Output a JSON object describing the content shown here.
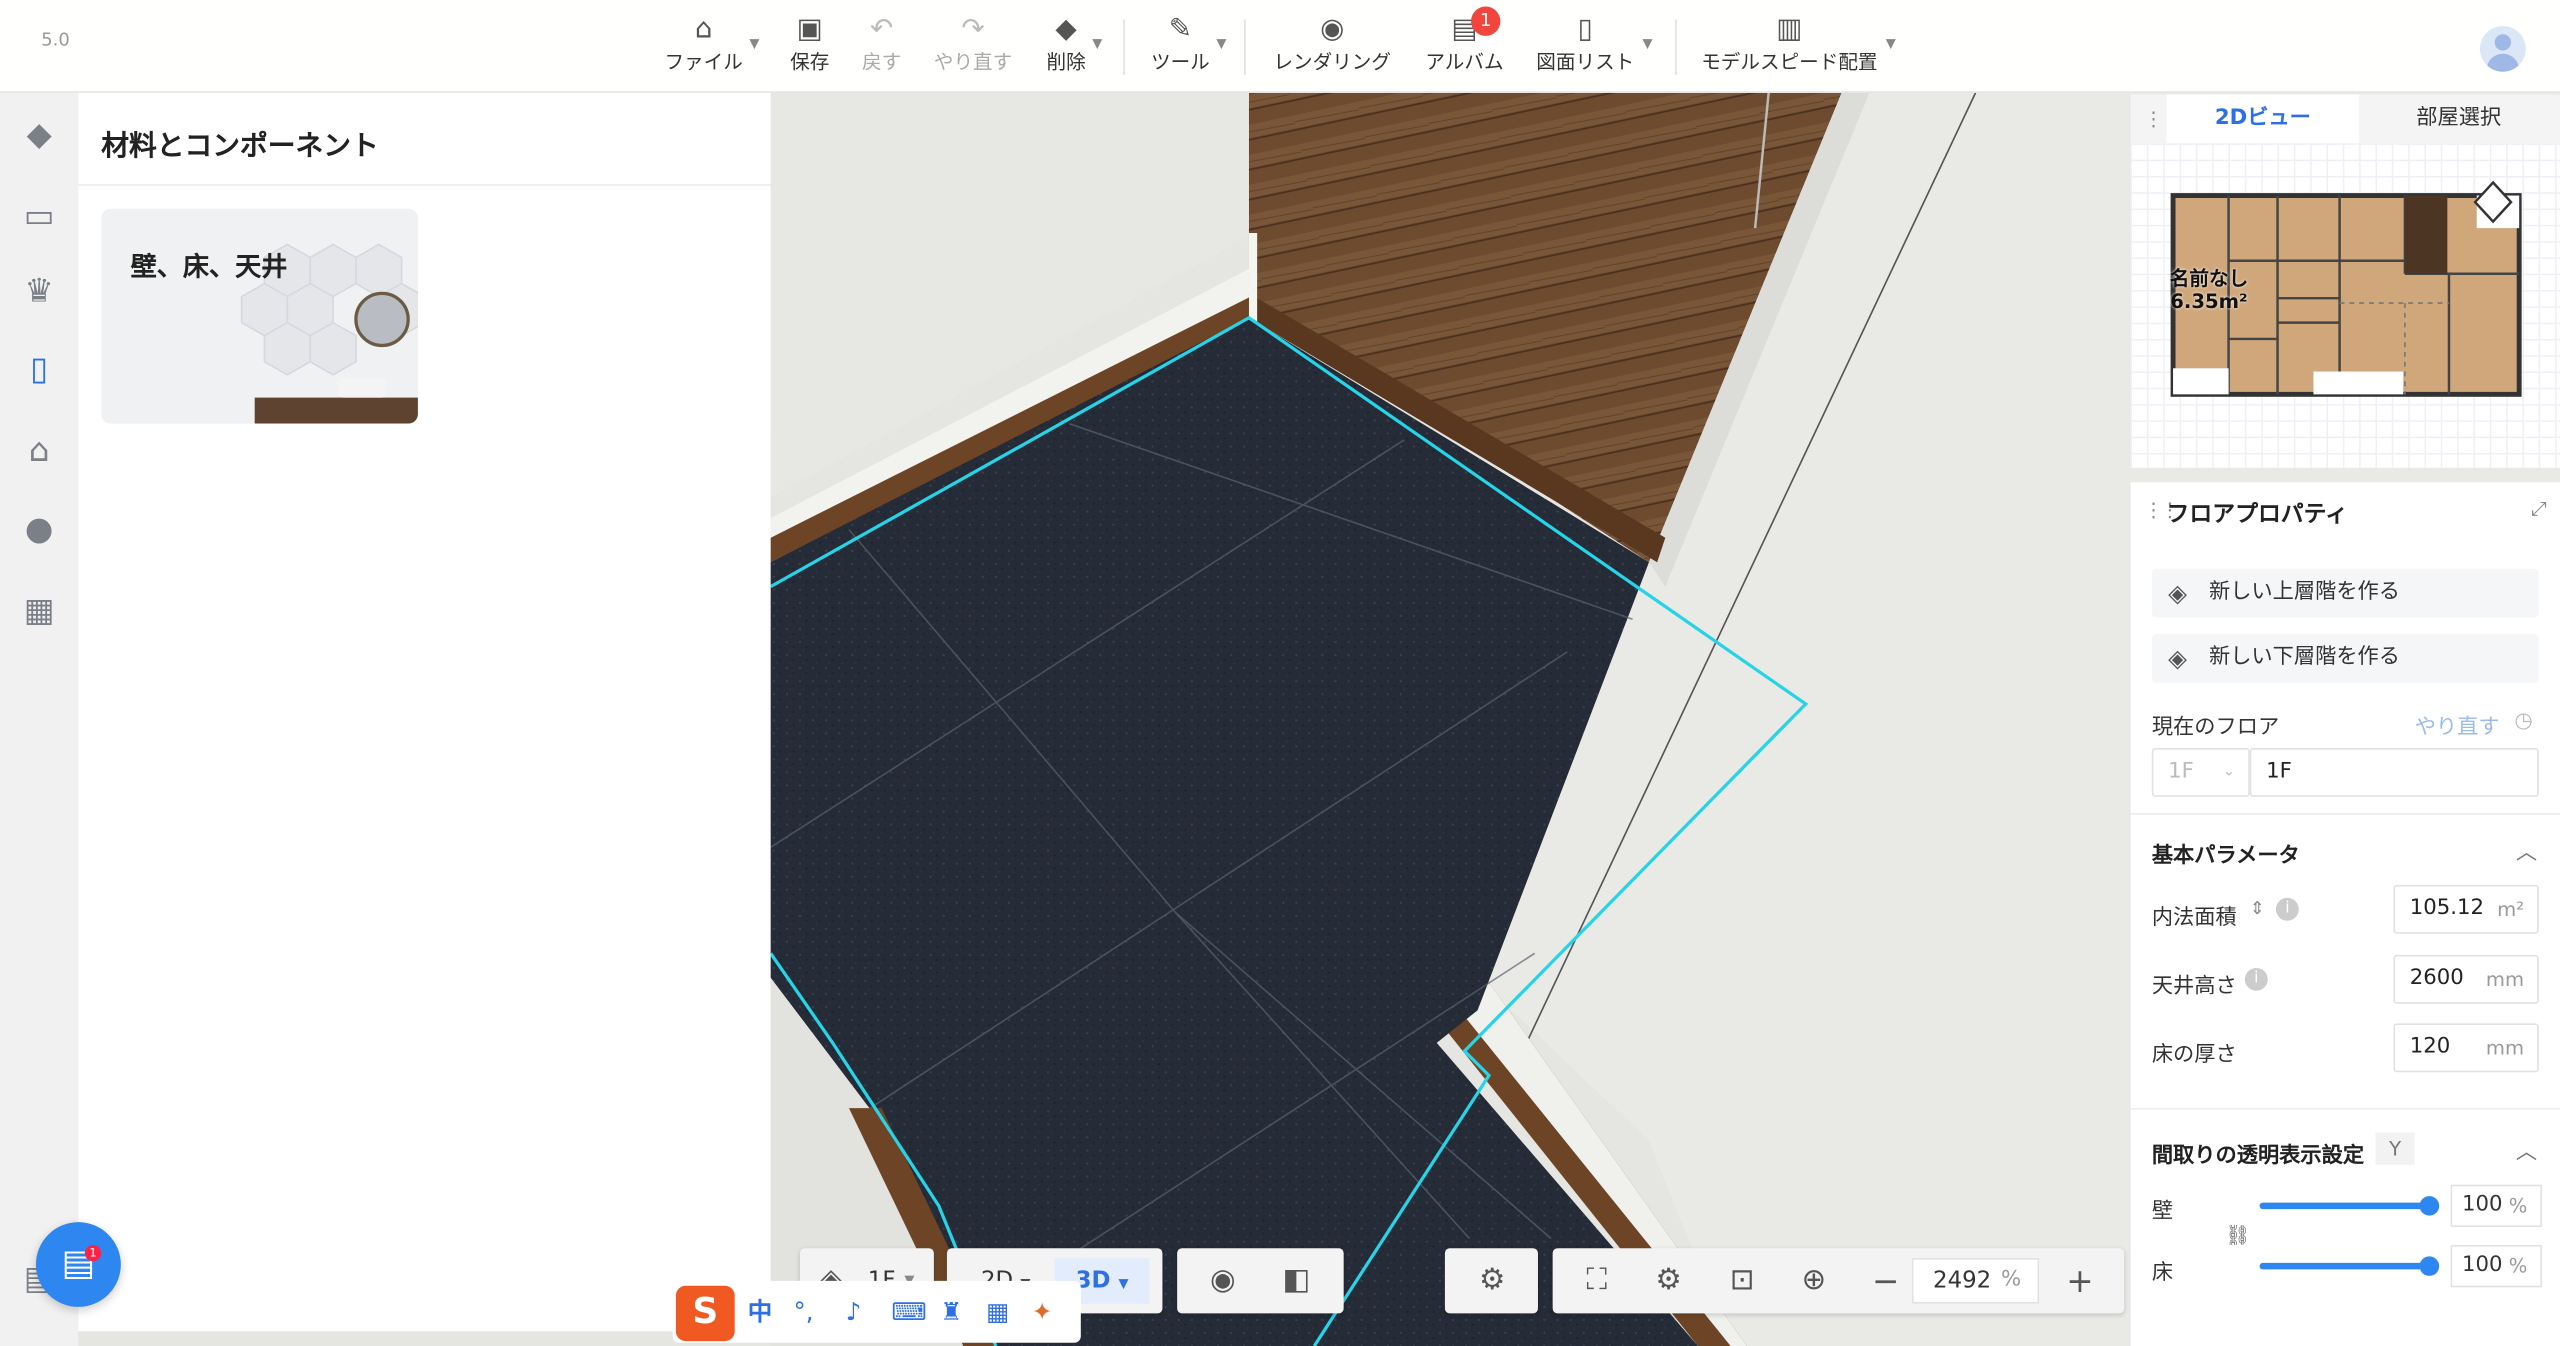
{
  "app": {
    "version": "5.0"
  },
  "toolbar": {
    "file": "ファイル",
    "save": "保存",
    "undo": "戻す",
    "redo": "やり直す",
    "delete": "削除",
    "tools": "ツール",
    "render": "レンダリング",
    "album": "アルバム",
    "album_badge": "1",
    "plan_list": "図面リスト",
    "model_speed": "モデルスピード配置"
  },
  "left_panel": {
    "title": "材料とコンポーネント",
    "card_label": "壁、床、天井"
  },
  "minimap": {
    "tab_2d": "2Dビュー",
    "tab_room": "部屋選択",
    "room_name": "名前なし",
    "room_area": "6.35m²"
  },
  "floor_props": {
    "title": "フロアプロパティ",
    "new_upper": "新しい上層階を作る",
    "new_lower": "新しい下層階を作る",
    "current_floor_label": "現在のフロア",
    "redo_label": "やり直す",
    "floor_select": "1F",
    "floor_name": "1F",
    "basic_params": "基本パラメータ",
    "area_label": "内法面積",
    "area_value": "105.12",
    "area_unit": "m²",
    "ceiling_label": "天井高さ",
    "ceiling_value": "2600",
    "ceiling_unit": "mm",
    "floor_thick_label": "床の厚さ",
    "floor_thick_value": "120",
    "floor_thick_unit": "mm",
    "transparency_title": "間取りの透明表示設定",
    "transparency_key": "Y",
    "wall_label": "壁",
    "wall_value": "100",
    "floor_label": "床",
    "floor_value": "100",
    "pct": "%",
    "wall_level": 1.0,
    "floor_level": 1.0
  },
  "bottom": {
    "floor": "1F",
    "view_2d": "2D",
    "view_3d": "3D",
    "zoom": "2492",
    "zoom_unit": "%"
  },
  "ime": {
    "logo": "S",
    "lang": "中"
  },
  "colors": {
    "accent": "#2e6fe6",
    "selection_outline": "#27d3e6",
    "floor_tile": "#232a36",
    "wood": "#6b4a30"
  }
}
